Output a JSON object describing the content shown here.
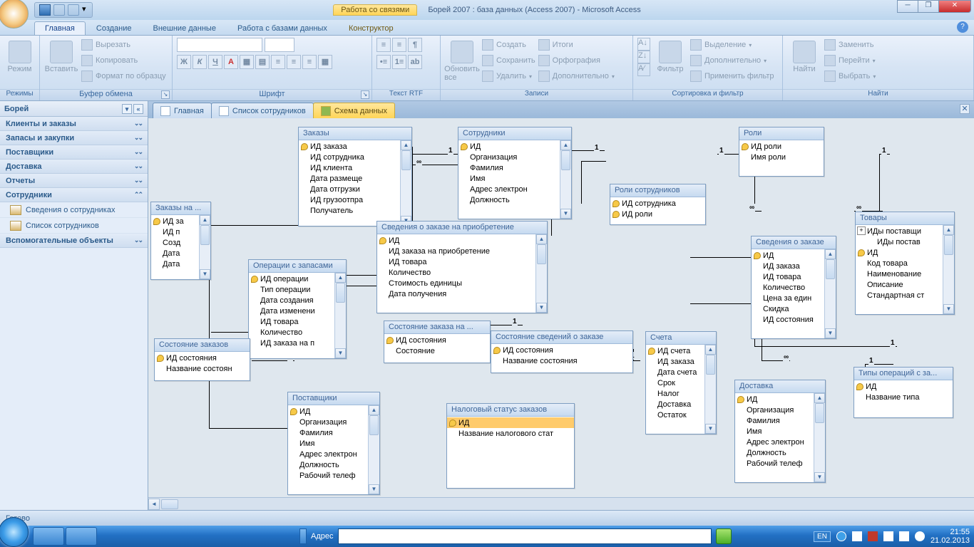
{
  "title": {
    "context_tab": "Работа со связями",
    "app": "Борей 2007 : база данных (Access 2007) - Microsoft Access"
  },
  "ribbon_tabs": [
    "Главная",
    "Создание",
    "Внешние данные",
    "Работа с базами данных",
    "Конструктор"
  ],
  "ribbon": {
    "modes": {
      "label": "Режим",
      "title": "Режимы"
    },
    "clipboard": {
      "paste": "Вставить",
      "cut": "Вырезать",
      "copy": "Копировать",
      "format": "Формат по образцу",
      "title": "Буфер обмена"
    },
    "font": {
      "title": "Шрифт"
    },
    "rtf": {
      "title": "Текст RTF"
    },
    "records": {
      "refresh": "Обновить все",
      "new": "Создать",
      "save": "Сохранить",
      "delete": "Удалить",
      "totals": "Итоги",
      "spelling": "Орфография",
      "more": "Дополнительно",
      "title": "Записи"
    },
    "sortfilter": {
      "filter": "Фильтр",
      "selection": "Выделение",
      "advanced": "Дополнительно",
      "toggle": "Применить фильтр",
      "title": "Сортировка и фильтр"
    },
    "find": {
      "find": "Найти",
      "replace": "Заменить",
      "goto": "Перейти",
      "select": "Выбрать",
      "title": "Найти"
    }
  },
  "nav": {
    "header": "Борей",
    "groups": {
      "g1": "Клиенты и заказы",
      "g2": "Запасы и закупки",
      "g3": "Поставщики",
      "g4": "Доставка",
      "g5": "Отчеты",
      "g6": "Сотрудники",
      "g7": "Вспомогательные объекты"
    },
    "items": {
      "i1": "Сведения о сотрудниках",
      "i2": "Список сотрудников"
    }
  },
  "doctabs": {
    "t1": "Главная",
    "t2": "Список сотрудников",
    "t3": "Схема данных"
  },
  "tables": {
    "orders": {
      "title": "Заказы",
      "f": [
        "ИД заказа",
        "ИД сотрудника",
        "ИД клиента",
        "Дата размеще",
        "Дата отгрузки",
        "ИД грузоотпра",
        "Получатель"
      ]
    },
    "po": {
      "title": "Заказы на ...",
      "f": [
        "ИД за",
        "ИД п",
        "Созд",
        "Дата",
        "Дата"
      ]
    },
    "inv": {
      "title": "Операции с запасами",
      "f": [
        "ИД операции",
        "Тип операции",
        "Дата создания",
        "Дата изменени",
        "ИД товара",
        "Количество",
        "ИД заказа на п"
      ]
    },
    "ostat": {
      "title": "Состояние заказов",
      "f": [
        "ИД состояния",
        "Название состоян"
      ]
    },
    "supp": {
      "title": "Поставщики",
      "f": [
        "ИД",
        "Организация",
        "Фамилия",
        "Имя",
        "Адрес электрон",
        "Должность",
        "Рабочий телеф"
      ]
    },
    "emp": {
      "title": "Сотрудники",
      "f": [
        "ИД",
        "Организация",
        "Фамилия",
        "Имя",
        "Адрес электрон",
        "Должность"
      ]
    },
    "podet": {
      "title": "Сведения о заказе на приобретение",
      "f": [
        "ИД",
        "ИД заказа на приобретение",
        "ИД товара",
        "Количество",
        "Стоимость единицы",
        "Дата получения"
      ]
    },
    "postat": {
      "title": "Состояние заказа на ...",
      "f": [
        "ИД состояния",
        "Состояние"
      ]
    },
    "odstat": {
      "title": "Состояние сведений о заказе",
      "f": [
        "ИД состояния",
        "Название состояния"
      ]
    },
    "tax": {
      "title": "Налоговый статус заказов",
      "f": [
        "ИД",
        "Название налогового стат"
      ]
    },
    "eroles": {
      "title": "Роли сотрудников",
      "f": [
        "ИД сотрудника",
        "ИД роли"
      ]
    },
    "roles": {
      "title": "Роли",
      "f": [
        "ИД роли",
        "Имя роли"
      ]
    },
    "invoice": {
      "title": "Счета",
      "f": [
        "ИД счета",
        "ИД заказа",
        "Дата счета",
        "Срок",
        "Налог",
        "Доставка",
        "Остаток"
      ]
    },
    "odet": {
      "title": "Сведения о заказе",
      "f": [
        "ИД",
        "ИД заказа",
        "ИД товара",
        "Количество",
        "Цена за един",
        "Скидка",
        "ИД состояния"
      ]
    },
    "ship": {
      "title": "Доставка",
      "f": [
        "ИД",
        "Организация",
        "Фамилия",
        "Имя",
        "Адрес электрон",
        "Должность",
        "Рабочий телеф"
      ]
    },
    "prod": {
      "title": "Товары",
      "f": [
        "ИДы поставщи",
        "ИДы постав",
        "ИД",
        "Код товара",
        "Наименование",
        "Описание",
        "Стандартная ст"
      ]
    },
    "itypes": {
      "title": "Типы операций с за...",
      "f": [
        "ИД",
        "Название типа"
      ]
    }
  },
  "status": "Готово",
  "taskbar": {
    "address_label": "Адрес",
    "lang": "EN",
    "time": "21:55",
    "date": "21.02.2013"
  }
}
